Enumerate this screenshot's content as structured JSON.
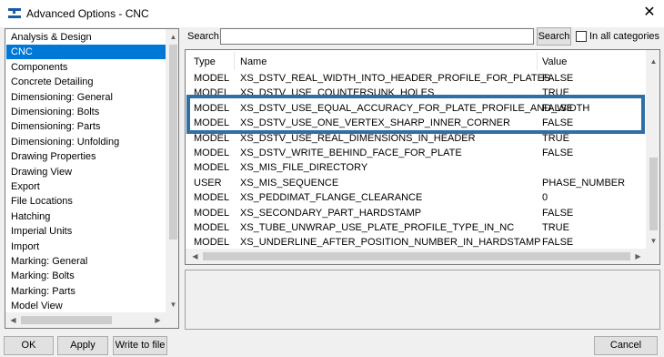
{
  "window": {
    "title": "Advanced Options - CNC",
    "close_glyph": "✕",
    "app_icon": "tekla-icon"
  },
  "categories": {
    "selected": "CNC",
    "items": [
      "Analysis & Design",
      "CNC",
      "Components",
      "Concrete Detailing",
      "Dimensioning: General",
      "Dimensioning: Bolts",
      "Dimensioning: Parts",
      "Dimensioning: Unfolding",
      "Drawing Properties",
      "Drawing View",
      "Export",
      "File Locations",
      "Hatching",
      "Imperial Units",
      "Import",
      "Marking: General",
      "Marking: Bolts",
      "Marking: Parts",
      "Model View"
    ]
  },
  "search": {
    "label": "Search",
    "value": "",
    "button_label": "Search",
    "all_categories_label": "In all categories",
    "all_categories_checked": false
  },
  "table": {
    "columns": [
      "Type",
      "Name",
      "Value"
    ],
    "rows": [
      {
        "type": "MODEL",
        "name": "XS_DSTV_REAL_WIDTH_INTO_HEADER_PROFILE_FOR_PLATES",
        "value": "FALSE"
      },
      {
        "type": "MODEL",
        "name": "XS_DSTV_USE_COUNTERSUNK_HOLES",
        "value": "TRUE"
      },
      {
        "type": "MODEL",
        "name": "XS_DSTV_USE_EQUAL_ACCURACY_FOR_PLATE_PROFILE_AND_WIDTH",
        "value": "FALSE"
      },
      {
        "type": "MODEL",
        "name": "XS_DSTV_USE_ONE_VERTEX_SHARP_INNER_CORNER",
        "value": "FALSE"
      },
      {
        "type": "MODEL",
        "name": "XS_DSTV_USE_REAL_DIMENSIONS_IN_HEADER",
        "value": "TRUE"
      },
      {
        "type": "MODEL",
        "name": "XS_DSTV_WRITE_BEHIND_FACE_FOR_PLATE",
        "value": "FALSE"
      },
      {
        "type": "MODEL",
        "name": "XS_MIS_FILE_DIRECTORY",
        "value": ""
      },
      {
        "type": "USER",
        "name": "XS_MIS_SEQUENCE",
        "value": "PHASE_NUMBER"
      },
      {
        "type": "MODEL",
        "name": "XS_PEDDIMAT_FLANGE_CLEARANCE",
        "value": "0"
      },
      {
        "type": "MODEL",
        "name": "XS_SECONDARY_PART_HARDSTAMP",
        "value": "FALSE"
      },
      {
        "type": "MODEL",
        "name": "XS_TUBE_UNWRAP_USE_PLATE_PROFILE_TYPE_IN_NC",
        "value": "TRUE"
      },
      {
        "type": "MODEL",
        "name": "XS_UNDERLINE_AFTER_POSITION_NUMBER_IN_HARDSTAMP",
        "value": "FALSE"
      }
    ]
  },
  "description": "",
  "buttons": {
    "ok": "OK",
    "apply": "Apply",
    "write": "Write to file",
    "cancel": "Cancel"
  },
  "colors": {
    "selection": "#0078d7",
    "highlight_box": "#2f6fa5"
  }
}
